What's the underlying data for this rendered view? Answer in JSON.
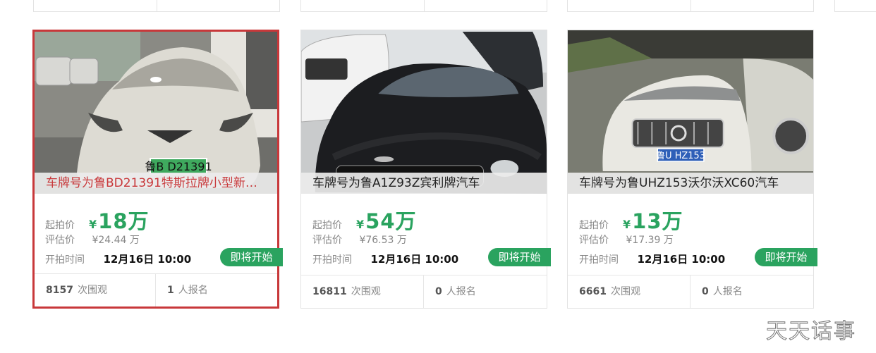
{
  "cards": [
    {
      "title": "车牌号为鲁BD21391特斯拉牌小型新…",
      "start_price_label": "起拍价",
      "currency": "¥",
      "start_price": "18万",
      "estimate_label": "评估价",
      "estimate": "¥24.44 万",
      "time_label": "开拍时间",
      "time": "12月16日 10:00",
      "status": "即将开始",
      "views": "8157",
      "views_label": "次围观",
      "signups": "1",
      "signups_label": "人报名",
      "plate": "鲁B D21391",
      "selected": true
    },
    {
      "title": "车牌号为鲁A1Z93Z宾利牌汽车",
      "start_price_label": "起拍价",
      "currency": "¥",
      "start_price": "54万",
      "estimate_label": "评估价",
      "estimate": "¥76.53 万",
      "time_label": "开拍时间",
      "time": "12月16日 10:00",
      "status": "即将开始",
      "views": "16811",
      "views_label": "次围观",
      "signups": "0",
      "signups_label": "人报名",
      "selected": false
    },
    {
      "title": "车牌号为鲁UHZ153沃尔沃XC60汽车",
      "start_price_label": "起拍价",
      "currency": "¥",
      "start_price": "13万",
      "estimate_label": "评估价",
      "estimate": "¥17.39 万",
      "time_label": "开拍时间",
      "time": "12月16日 10:00",
      "status": "即将开始",
      "views": "6661",
      "views_label": "次围观",
      "signups": "0",
      "signups_label": "人报名",
      "plate": "鲁U HZ153",
      "selected": false
    }
  ],
  "watermark": "天天话事",
  "colors": {
    "accent_green": "#2aa35f",
    "selected_red": "#c8383a"
  }
}
